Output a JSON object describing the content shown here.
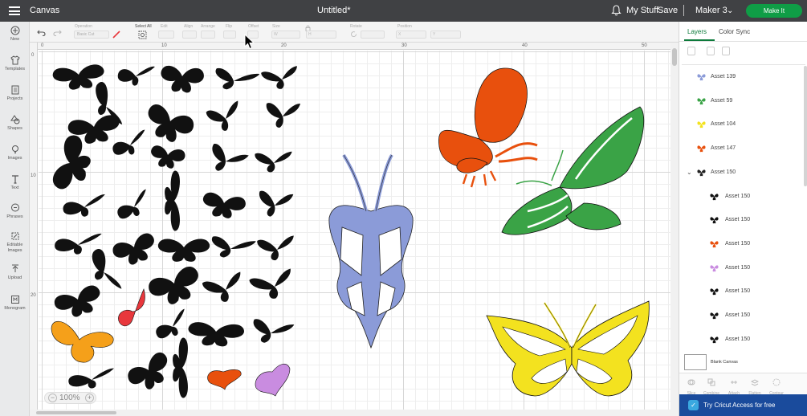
{
  "topbar": {
    "app_title": "Canvas",
    "doc_title": "Untitled*",
    "my_stuff": "My Stuff",
    "save": "Save",
    "separator": "|",
    "machine": "Maker 3",
    "make_it": "Make It"
  },
  "sidebar": {
    "items": [
      {
        "label": "New",
        "icon": "plus-circle-icon"
      },
      {
        "label": "Templates",
        "icon": "shirt-icon"
      },
      {
        "label": "Projects",
        "icon": "projects-icon"
      },
      {
        "label": "Shapes",
        "icon": "shapes-icon"
      },
      {
        "label": "Images",
        "icon": "lightbulb-icon"
      },
      {
        "label": "Text",
        "icon": "text-icon"
      },
      {
        "label": "Phrases",
        "icon": "speech-bubble-icon"
      },
      {
        "label": "Editable Images",
        "icon": "editable-images-icon"
      },
      {
        "label": "Upload",
        "icon": "upload-icon"
      },
      {
        "label": "Monogram",
        "icon": "monogram-icon"
      }
    ]
  },
  "toolbar": {
    "operation_label": "Operation",
    "operation_value": "Basic Cut",
    "select_all": "Select All",
    "edit": "Edit",
    "align": "Align",
    "arrange": "Arrange",
    "flip": "Flip",
    "offset": "Offset",
    "size": "Size",
    "size_w": "W",
    "size_h": "H",
    "rotate": "Rotate",
    "position": "Position",
    "pos_x": "X",
    "pos_y": "Y"
  },
  "rulers": {
    "h": [
      "0",
      "10",
      "20",
      "30",
      "40",
      "50"
    ],
    "v": [
      "0",
      "10",
      "20"
    ]
  },
  "zoom": {
    "minus": "−",
    "value": "100%",
    "plus": "+"
  },
  "panel": {
    "tabs": [
      "Layers",
      "Color Sync"
    ],
    "layers": [
      {
        "name": "Asset 139",
        "color": "#8b9bd8",
        "indent": false
      },
      {
        "name": "Asset 59",
        "color": "#3aa346",
        "indent": false
      },
      {
        "name": "Asset 104",
        "color": "#f3e21f",
        "indent": false
      },
      {
        "name": "Asset 147",
        "color": "#e8500d",
        "indent": false
      },
      {
        "name": "Asset 150",
        "color": "#222222",
        "indent": false,
        "group": true
      },
      {
        "name": "Asset 150",
        "color": "#111111",
        "indent": true
      },
      {
        "name": "Asset 150",
        "color": "#111111",
        "indent": true
      },
      {
        "name": "Asset 150",
        "color": "#e8500d",
        "indent": true
      },
      {
        "name": "Asset 150",
        "color": "#c98ce0",
        "indent": true
      },
      {
        "name": "Asset 150",
        "color": "#111111",
        "indent": true
      },
      {
        "name": "Asset 150",
        "color": "#111111",
        "indent": true
      },
      {
        "name": "Asset 150",
        "color": "#111111",
        "indent": true
      }
    ],
    "blank_canvas": "Blank Canvas",
    "bottom_tools": [
      "Slice",
      "Combine",
      "Attach",
      "Flatten",
      "Contour"
    ],
    "access": "Try Cricut Access for free"
  },
  "colors": {
    "topbar": "#404144",
    "make_it": "#0f9d46",
    "access": "#1a4b9c",
    "periwinkle": "#8b9bd8",
    "green": "#3aa346",
    "yellow": "#f3e21f",
    "orange": "#e8500d",
    "light_orange": "#f5a01a",
    "red": "#e8373c",
    "purple": "#c98ce0"
  }
}
